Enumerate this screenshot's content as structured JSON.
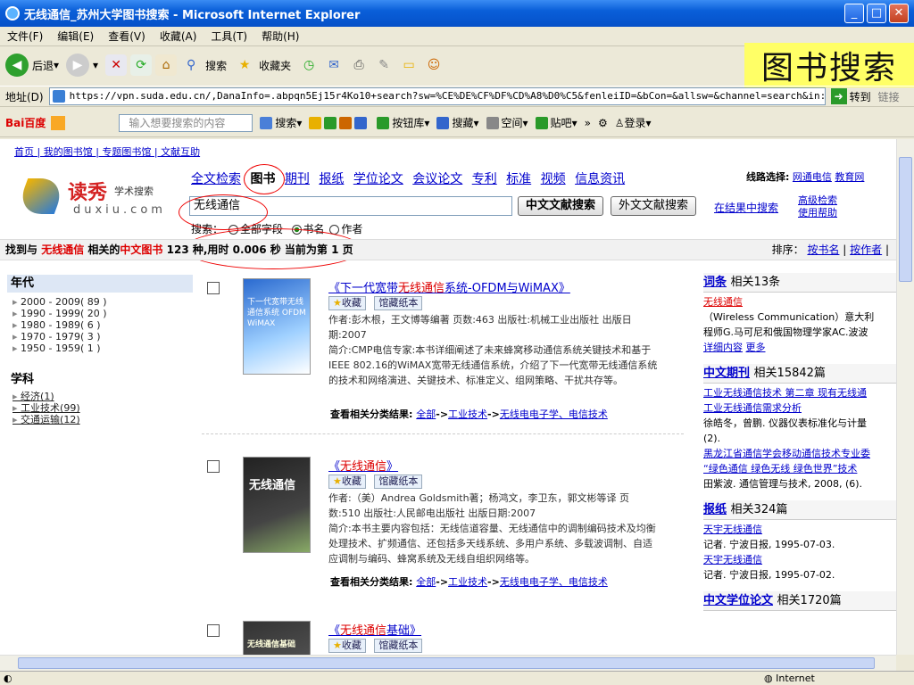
{
  "window": {
    "title": "无线通信_苏州大学图书搜索 - Microsoft Internet Explorer"
  },
  "menu": [
    "文件(F)",
    "编辑(E)",
    "查看(V)",
    "收藏(A)",
    "工具(T)",
    "帮助(H)"
  ],
  "toolbar": {
    "back": "后退",
    "search": "搜索",
    "favorites": "收藏夹"
  },
  "overlay_title": "图书搜索",
  "address": {
    "label": "地址(D)",
    "url": "https://vpn.suda.edu.cn/,DanaInfo=.abpqn5Ej15r4Ko10+search?sw=%CE%DE%CF%DF%CD%A8%D0%C5&fenleiID=&bCon=&allsw=&channel=search&in:",
    "go": "转到",
    "links": "链接"
  },
  "baidu": {
    "logo": "Bai百度",
    "placeholder": "输入想要搜索的内容",
    "search": "搜索",
    "button_lib": "按钮库",
    "collect": "搜藏",
    "space": "空间",
    "tieba": "贴吧",
    "login": "登录"
  },
  "page": {
    "toplinks": "首页 | 我的图书馆 | 专题图书馆 | 文献互助",
    "logo": {
      "cn": "读秀",
      "sub": "学术搜索",
      "en": "duxiu.com"
    },
    "tabs": [
      "全文检索",
      "图书",
      "期刊",
      "报纸",
      "学位论文",
      "会议论文",
      "专利",
      "标准",
      "视频",
      "信息资讯"
    ],
    "route_label": "线路选择:",
    "route_links": [
      "网通电信",
      "教育网"
    ],
    "search_value": "无线通信",
    "btn_cn": "中文文献搜索",
    "btn_foreign": "外文文献搜索",
    "in_results": "在结果中搜索",
    "advanced": "高级检索",
    "help": "使用帮助",
    "options_label": "搜索：",
    "opt_all": "全部字段",
    "opt_title": "书名",
    "opt_author": "作者",
    "stats": {
      "prefix": "找到与",
      "kw": "无线通信",
      "mid": "相关的",
      "type": "中文图书",
      "rest": "123 种,用时 0.006 秒 当前为第 1 页"
    },
    "sort": {
      "label": "排序：",
      "by_title": "按书名",
      "by_author": "按作者"
    }
  },
  "facets": [
    {
      "title": "年代",
      "items": [
        "2000 - 2009( 89 )",
        "1990 - 1999( 20 )",
        "1980 - 1989( 6 )",
        "1970 - 1979( 3 )",
        "1950 - 1959( 1 )"
      ]
    },
    {
      "title": "学科",
      "items": [
        "经济(1)",
        "工业技术(99)",
        "交通运输(12)"
      ]
    }
  ],
  "results": [
    {
      "title_pre": "《下一代宽带",
      "title_hl": "无线通信",
      "title_post": "系统-OFDM与WiMAX》",
      "tag1": "收藏",
      "tag2": "馆藏纸本",
      "meta": "作者:彭木根，王文博等编著 页数:463 出版社:机械工业出版社 出版日期:2007",
      "abstract": "简介:CMP电信专家:本书详细阐述了未来蜂窝移动通信系统关键技术和基于IEEE 802.16的WiMAX宽带无线通信系统，介绍了下一代宽带无线通信系统的技术和网络演进、关键技术、标准定义、组网策略、干扰共存等。",
      "cat_label": "查看相关分类结果:",
      "cat_links": [
        "全部",
        "工业技术",
        "无线电电子学、电信技术"
      ],
      "cover_text": "下一代宽带无线通信系统 OFDM WiMAX"
    },
    {
      "title_pre": "《",
      "title_hl": "无线通信",
      "title_post": "》",
      "tag1": "收藏",
      "tag2": "馆藏纸本",
      "meta": "作者:（美）Andrea Goldsmith著；杨鸿文，李卫东，郭文彬等译 页数:510 出版社:人民邮电出版社 出版日期:2007",
      "abstract": "简介:本书主要内容包括：无线信道容量、无线通信中的调制编码技术及均衡处理技术、扩频通信、还包括多天线系统、多用户系统、多载波调制、自适应调制与编码、蜂窝系统及无线自组织网络等。",
      "cat_label": "查看相关分类结果:",
      "cat_links": [
        "全部",
        "工业技术",
        "无线电电子学、电信技术"
      ],
      "cover_text": "无线通信"
    },
    {
      "title_pre": "《",
      "title_hl": "无线通信",
      "title_post": "基础》",
      "tag1": "收藏",
      "tag2": "馆藏纸本",
      "cover_text": "无线通信基础"
    }
  ],
  "right": {
    "entry": {
      "title": "词条",
      "count": "相关13条",
      "link": "无线通信",
      "text1": "（Wireless Communication）意大利",
      "text2": "程师G.马可尼和俄国物理学家AC.波波",
      "more1": "详细内容",
      "more2": "更多"
    },
    "journal": {
      "title": "中文期刊",
      "count": "相关15842篇",
      "links": [
        "工业无线通信技术 第二章 现有无线通",
        "工业无线通信需求分析"
      ],
      "text1": "徐皓冬，曾鹏. 仪器仪表标准化与计量",
      "text2": "(2).",
      "links2": [
        "黑龙江省通信学会移动通信技术专业委",
        "“绿色通信 绿色无线 绿色世界”技术"
      ],
      "text3": "田紫波. 通信管理与技术, 2008, (6)."
    },
    "news": {
      "title": "报纸",
      "count": "相关324篇",
      "items": [
        {
          "link": "天宇无线通信",
          "text": "记者. 宁波日报, 1995-07-03."
        },
        {
          "link": "天宇无线通信",
          "text": "记者. 宁波日报, 1995-07-02."
        }
      ]
    },
    "thesis": {
      "title": "中文学位论文",
      "count": "相关1720篇"
    }
  },
  "status": {
    "zone": "Internet"
  }
}
